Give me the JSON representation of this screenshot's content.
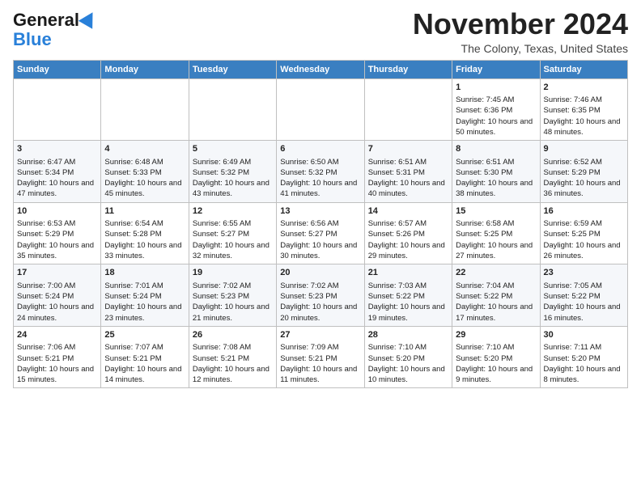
{
  "header": {
    "logo": {
      "general": "General",
      "blue": "Blue"
    },
    "month": "November 2024",
    "location": "The Colony, Texas, United States"
  },
  "days_of_week": [
    "Sunday",
    "Monday",
    "Tuesday",
    "Wednesday",
    "Thursday",
    "Friday",
    "Saturday"
  ],
  "weeks": [
    {
      "row": 1,
      "days": [
        {
          "num": "",
          "content": ""
        },
        {
          "num": "",
          "content": ""
        },
        {
          "num": "",
          "content": ""
        },
        {
          "num": "",
          "content": ""
        },
        {
          "num": "",
          "content": ""
        },
        {
          "num": "1",
          "content": "Sunrise: 7:45 AM\nSunset: 6:36 PM\nDaylight: 10 hours and 50 minutes."
        },
        {
          "num": "2",
          "content": "Sunrise: 7:46 AM\nSunset: 6:35 PM\nDaylight: 10 hours and 48 minutes."
        }
      ]
    },
    {
      "row": 2,
      "days": [
        {
          "num": "3",
          "content": "Sunrise: 6:47 AM\nSunset: 5:34 PM\nDaylight: 10 hours and 47 minutes."
        },
        {
          "num": "4",
          "content": "Sunrise: 6:48 AM\nSunset: 5:33 PM\nDaylight: 10 hours and 45 minutes."
        },
        {
          "num": "5",
          "content": "Sunrise: 6:49 AM\nSunset: 5:32 PM\nDaylight: 10 hours and 43 minutes."
        },
        {
          "num": "6",
          "content": "Sunrise: 6:50 AM\nSunset: 5:32 PM\nDaylight: 10 hours and 41 minutes."
        },
        {
          "num": "7",
          "content": "Sunrise: 6:51 AM\nSunset: 5:31 PM\nDaylight: 10 hours and 40 minutes."
        },
        {
          "num": "8",
          "content": "Sunrise: 6:51 AM\nSunset: 5:30 PM\nDaylight: 10 hours and 38 minutes."
        },
        {
          "num": "9",
          "content": "Sunrise: 6:52 AM\nSunset: 5:29 PM\nDaylight: 10 hours and 36 minutes."
        }
      ]
    },
    {
      "row": 3,
      "days": [
        {
          "num": "10",
          "content": "Sunrise: 6:53 AM\nSunset: 5:29 PM\nDaylight: 10 hours and 35 minutes."
        },
        {
          "num": "11",
          "content": "Sunrise: 6:54 AM\nSunset: 5:28 PM\nDaylight: 10 hours and 33 minutes."
        },
        {
          "num": "12",
          "content": "Sunrise: 6:55 AM\nSunset: 5:27 PM\nDaylight: 10 hours and 32 minutes."
        },
        {
          "num": "13",
          "content": "Sunrise: 6:56 AM\nSunset: 5:27 PM\nDaylight: 10 hours and 30 minutes."
        },
        {
          "num": "14",
          "content": "Sunrise: 6:57 AM\nSunset: 5:26 PM\nDaylight: 10 hours and 29 minutes."
        },
        {
          "num": "15",
          "content": "Sunrise: 6:58 AM\nSunset: 5:25 PM\nDaylight: 10 hours and 27 minutes."
        },
        {
          "num": "16",
          "content": "Sunrise: 6:59 AM\nSunset: 5:25 PM\nDaylight: 10 hours and 26 minutes."
        }
      ]
    },
    {
      "row": 4,
      "days": [
        {
          "num": "17",
          "content": "Sunrise: 7:00 AM\nSunset: 5:24 PM\nDaylight: 10 hours and 24 minutes."
        },
        {
          "num": "18",
          "content": "Sunrise: 7:01 AM\nSunset: 5:24 PM\nDaylight: 10 hours and 23 minutes."
        },
        {
          "num": "19",
          "content": "Sunrise: 7:02 AM\nSunset: 5:23 PM\nDaylight: 10 hours and 21 minutes."
        },
        {
          "num": "20",
          "content": "Sunrise: 7:02 AM\nSunset: 5:23 PM\nDaylight: 10 hours and 20 minutes."
        },
        {
          "num": "21",
          "content": "Sunrise: 7:03 AM\nSunset: 5:22 PM\nDaylight: 10 hours and 19 minutes."
        },
        {
          "num": "22",
          "content": "Sunrise: 7:04 AM\nSunset: 5:22 PM\nDaylight: 10 hours and 17 minutes."
        },
        {
          "num": "23",
          "content": "Sunrise: 7:05 AM\nSunset: 5:22 PM\nDaylight: 10 hours and 16 minutes."
        }
      ]
    },
    {
      "row": 5,
      "days": [
        {
          "num": "24",
          "content": "Sunrise: 7:06 AM\nSunset: 5:21 PM\nDaylight: 10 hours and 15 minutes."
        },
        {
          "num": "25",
          "content": "Sunrise: 7:07 AM\nSunset: 5:21 PM\nDaylight: 10 hours and 14 minutes."
        },
        {
          "num": "26",
          "content": "Sunrise: 7:08 AM\nSunset: 5:21 PM\nDaylight: 10 hours and 12 minutes."
        },
        {
          "num": "27",
          "content": "Sunrise: 7:09 AM\nSunset: 5:21 PM\nDaylight: 10 hours and 11 minutes."
        },
        {
          "num": "28",
          "content": "Sunrise: 7:10 AM\nSunset: 5:20 PM\nDaylight: 10 hours and 10 minutes."
        },
        {
          "num": "29",
          "content": "Sunrise: 7:10 AM\nSunset: 5:20 PM\nDaylight: 10 hours and 9 minutes."
        },
        {
          "num": "30",
          "content": "Sunrise: 7:11 AM\nSunset: 5:20 PM\nDaylight: 10 hours and 8 minutes."
        }
      ]
    }
  ]
}
